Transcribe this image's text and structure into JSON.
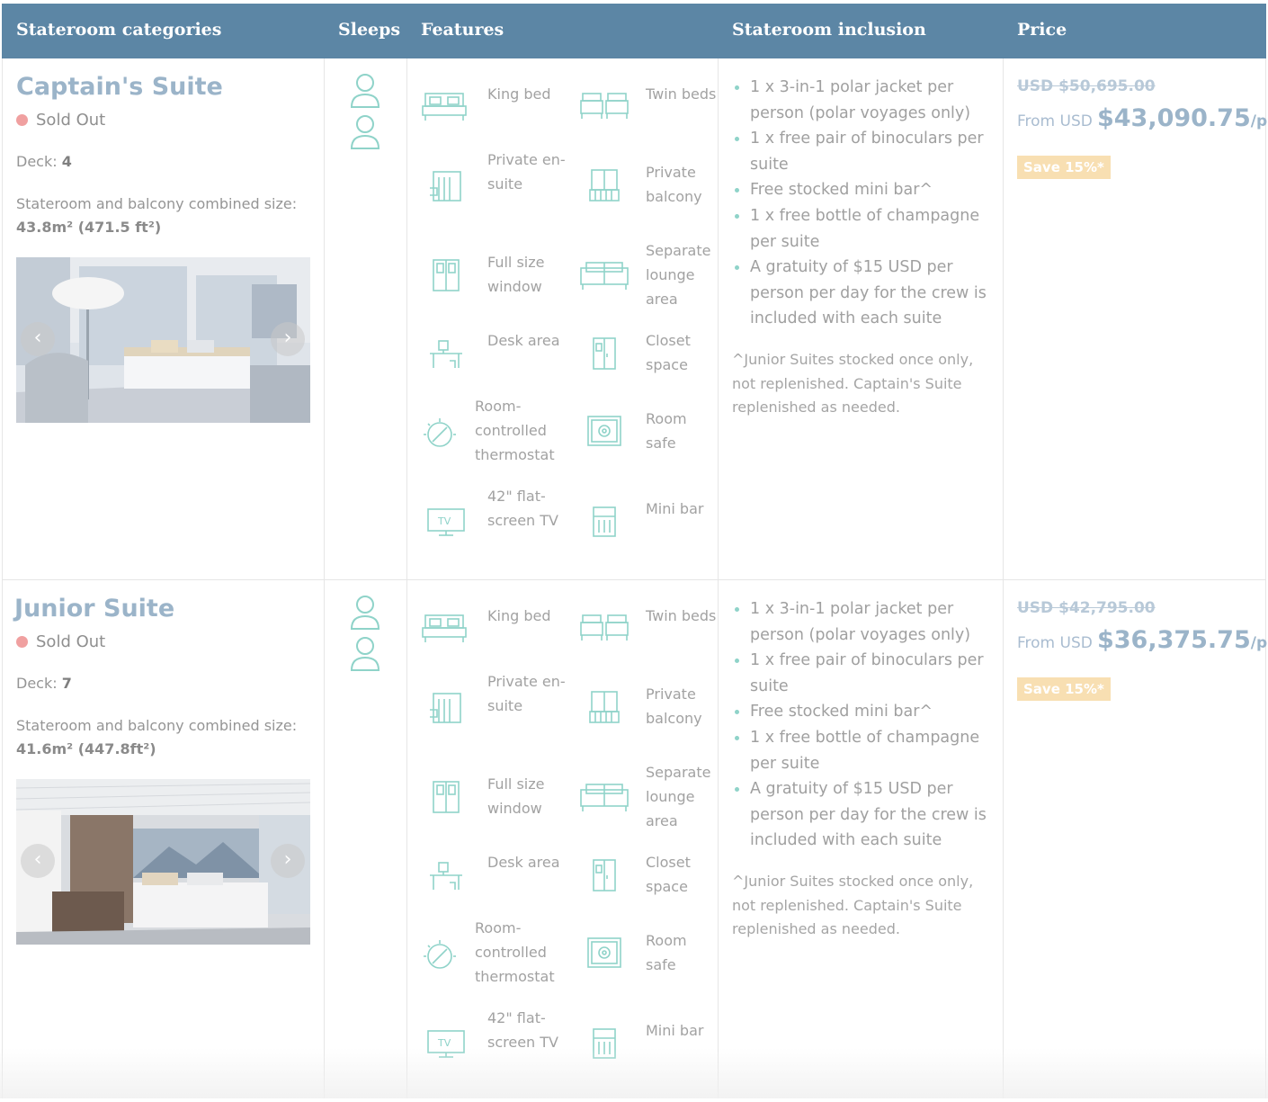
{
  "header": {
    "col_categories": "Stateroom categories",
    "col_sleeps": "Sleeps",
    "col_features": "Features",
    "col_inclusion": "Stateroom inclusion",
    "col_price": "Price"
  },
  "suites": [
    {
      "name": "Captain's Suite",
      "status": "Sold Out",
      "deck_label": "Deck:",
      "deck_value": "4",
      "size_label": "Stateroom and balcony combined size:",
      "size_value": "43.8m² (471.5 ft²)",
      "carousel_prev": "‹",
      "carousel_next": "›",
      "sleeps": 2,
      "features": [
        "King bed",
        "Twin beds",
        "Private en-suite",
        "Private balcony",
        "Full size window",
        "Separate lounge area",
        "Desk area",
        "Closet space",
        "Room-controlled thermostat",
        "Room safe",
        "42\" flat-screen TV",
        "Mini bar"
      ],
      "inclusions": [
        "1 x 3-in-1 polar jacket per person (polar voyages only)",
        "1 x free pair of binoculars per suite",
        "Free stocked mini bar^",
        "1 x free bottle of champagne per suite",
        "A gratuity of $15 USD per person per day for the crew is included with each suite"
      ],
      "inclusion_note": "^Junior Suites stocked once only, not replenished. Captain's Suite replenished as needed.",
      "was_price": "USD $50,695.00",
      "from_prefix": "From USD",
      "price": "$43,090.75",
      "per": "/pp",
      "save": "Save 15%*"
    },
    {
      "name": "Junior Suite",
      "status": "Sold Out",
      "deck_label": "Deck:",
      "deck_value": "7",
      "size_label": "Stateroom and balcony combined size:",
      "size_value": "41.6m² (447.8ft²)",
      "carousel_prev": "‹",
      "carousel_next": "›",
      "sleeps": 2,
      "features": [
        "King bed",
        "Twin beds",
        "Private en-suite",
        "Private balcony",
        "Full size window",
        "Separate lounge area",
        "Desk area",
        "Closet space",
        "Room-controlled thermostat",
        "Room safe",
        "42\" flat-screen TV",
        "Mini bar"
      ],
      "inclusions": [
        "1 x 3-in-1 polar jacket per person (polar voyages only)",
        "1 x free pair of binoculars per suite",
        "Free stocked mini bar^",
        "1 x free bottle of champagne per suite",
        "A gratuity of $15 USD per person per day for the crew is included with each suite"
      ],
      "inclusion_note": "^Junior Suites stocked once only, not replenished. Captain's Suite replenished as needed.",
      "was_price": "USD $42,795.00",
      "from_prefix": "From USD",
      "price": "$36,375.75",
      "per": "/pp",
      "save": "Save 15%*"
    }
  ],
  "colors": {
    "header_bg": "#5c86a5",
    "accent_teal": "#8fd3c9",
    "sold_out_dot": "#f0a0a0",
    "save_badge": "#f8dfb2",
    "price_blue": "#9bb4c9"
  },
  "feature_icon_names": [
    "king-bed-icon",
    "twin-beds-icon",
    "ensuite-shower-icon",
    "balcony-icon",
    "window-icon",
    "lounge-sofa-icon",
    "desk-icon",
    "closet-icon",
    "thermostat-icon",
    "safe-icon",
    "tv-icon",
    "mini-bar-icon"
  ]
}
